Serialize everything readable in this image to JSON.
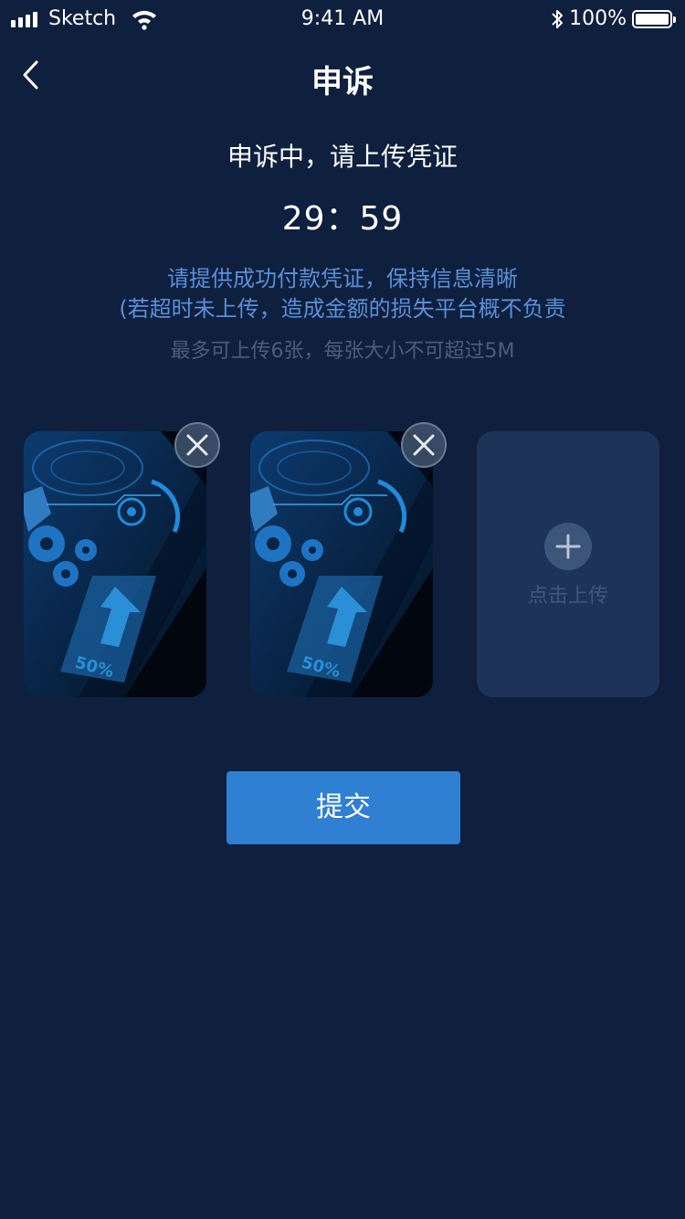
{
  "status_bar": {
    "carrier": "Sketch",
    "time": "9:41 AM",
    "battery": "100%",
    "bluetooth_glyph": "✱"
  },
  "nav": {
    "title": "申诉"
  },
  "appeal": {
    "status_text": "申诉中，请上传凭证",
    "countdown": "29：59",
    "hint_line1": "请提供成功付款凭证，保持信息清晰",
    "hint_line2": "(若超时未上传，造成金额的损失平台概不负责",
    "limit_note": "最多可上传6张，每张大小不可超过5M"
  },
  "uploads": {
    "images": [
      {
        "label": "50%"
      },
      {
        "label": "50%"
      }
    ],
    "add_label": "点击上传"
  },
  "submit_label": "提交",
  "colors": {
    "background": "#0e203e",
    "accent": "#2f7fd3",
    "hint": "#5b8fd8",
    "muted": "#4a5d7c",
    "upload_tile": "#1d3458"
  }
}
